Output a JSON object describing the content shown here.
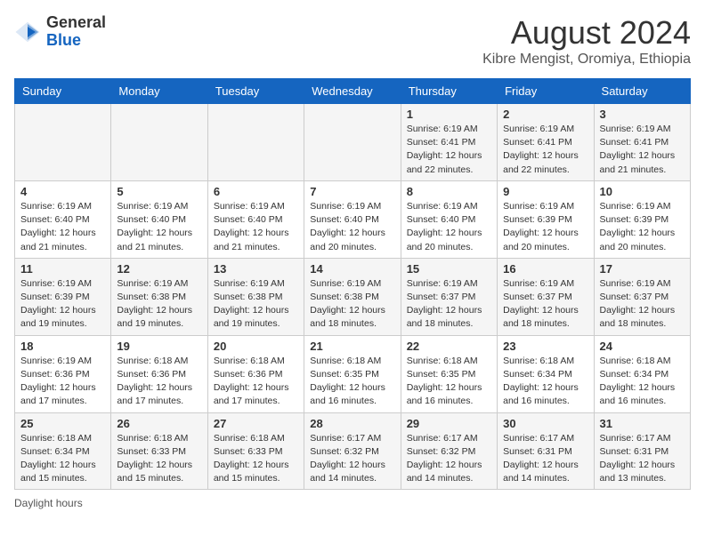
{
  "logo": {
    "general": "General",
    "blue": "Blue"
  },
  "title": "August 2024",
  "subtitle": "Kibre Mengist, Oromiya, Ethiopia",
  "days_of_week": [
    "Sunday",
    "Monday",
    "Tuesday",
    "Wednesday",
    "Thursday",
    "Friday",
    "Saturday"
  ],
  "footer": "Daylight hours",
  "weeks": [
    [
      {
        "day": "",
        "info": ""
      },
      {
        "day": "",
        "info": ""
      },
      {
        "day": "",
        "info": ""
      },
      {
        "day": "",
        "info": ""
      },
      {
        "day": "1",
        "info": "Sunrise: 6:19 AM\nSunset: 6:41 PM\nDaylight: 12 hours\nand 22 minutes."
      },
      {
        "day": "2",
        "info": "Sunrise: 6:19 AM\nSunset: 6:41 PM\nDaylight: 12 hours\nand 22 minutes."
      },
      {
        "day": "3",
        "info": "Sunrise: 6:19 AM\nSunset: 6:41 PM\nDaylight: 12 hours\nand 21 minutes."
      }
    ],
    [
      {
        "day": "4",
        "info": "Sunrise: 6:19 AM\nSunset: 6:40 PM\nDaylight: 12 hours\nand 21 minutes."
      },
      {
        "day": "5",
        "info": "Sunrise: 6:19 AM\nSunset: 6:40 PM\nDaylight: 12 hours\nand 21 minutes."
      },
      {
        "day": "6",
        "info": "Sunrise: 6:19 AM\nSunset: 6:40 PM\nDaylight: 12 hours\nand 21 minutes."
      },
      {
        "day": "7",
        "info": "Sunrise: 6:19 AM\nSunset: 6:40 PM\nDaylight: 12 hours\nand 20 minutes."
      },
      {
        "day": "8",
        "info": "Sunrise: 6:19 AM\nSunset: 6:40 PM\nDaylight: 12 hours\nand 20 minutes."
      },
      {
        "day": "9",
        "info": "Sunrise: 6:19 AM\nSunset: 6:39 PM\nDaylight: 12 hours\nand 20 minutes."
      },
      {
        "day": "10",
        "info": "Sunrise: 6:19 AM\nSunset: 6:39 PM\nDaylight: 12 hours\nand 20 minutes."
      }
    ],
    [
      {
        "day": "11",
        "info": "Sunrise: 6:19 AM\nSunset: 6:39 PM\nDaylight: 12 hours\nand 19 minutes."
      },
      {
        "day": "12",
        "info": "Sunrise: 6:19 AM\nSunset: 6:38 PM\nDaylight: 12 hours\nand 19 minutes."
      },
      {
        "day": "13",
        "info": "Sunrise: 6:19 AM\nSunset: 6:38 PM\nDaylight: 12 hours\nand 19 minutes."
      },
      {
        "day": "14",
        "info": "Sunrise: 6:19 AM\nSunset: 6:38 PM\nDaylight: 12 hours\nand 18 minutes."
      },
      {
        "day": "15",
        "info": "Sunrise: 6:19 AM\nSunset: 6:37 PM\nDaylight: 12 hours\nand 18 minutes."
      },
      {
        "day": "16",
        "info": "Sunrise: 6:19 AM\nSunset: 6:37 PM\nDaylight: 12 hours\nand 18 minutes."
      },
      {
        "day": "17",
        "info": "Sunrise: 6:19 AM\nSunset: 6:37 PM\nDaylight: 12 hours\nand 18 minutes."
      }
    ],
    [
      {
        "day": "18",
        "info": "Sunrise: 6:19 AM\nSunset: 6:36 PM\nDaylight: 12 hours\nand 17 minutes."
      },
      {
        "day": "19",
        "info": "Sunrise: 6:18 AM\nSunset: 6:36 PM\nDaylight: 12 hours\nand 17 minutes."
      },
      {
        "day": "20",
        "info": "Sunrise: 6:18 AM\nSunset: 6:36 PM\nDaylight: 12 hours\nand 17 minutes."
      },
      {
        "day": "21",
        "info": "Sunrise: 6:18 AM\nSunset: 6:35 PM\nDaylight: 12 hours\nand 16 minutes."
      },
      {
        "day": "22",
        "info": "Sunrise: 6:18 AM\nSunset: 6:35 PM\nDaylight: 12 hours\nand 16 minutes."
      },
      {
        "day": "23",
        "info": "Sunrise: 6:18 AM\nSunset: 6:34 PM\nDaylight: 12 hours\nand 16 minutes."
      },
      {
        "day": "24",
        "info": "Sunrise: 6:18 AM\nSunset: 6:34 PM\nDaylight: 12 hours\nand 16 minutes."
      }
    ],
    [
      {
        "day": "25",
        "info": "Sunrise: 6:18 AM\nSunset: 6:34 PM\nDaylight: 12 hours\nand 15 minutes."
      },
      {
        "day": "26",
        "info": "Sunrise: 6:18 AM\nSunset: 6:33 PM\nDaylight: 12 hours\nand 15 minutes."
      },
      {
        "day": "27",
        "info": "Sunrise: 6:18 AM\nSunset: 6:33 PM\nDaylight: 12 hours\nand 15 minutes."
      },
      {
        "day": "28",
        "info": "Sunrise: 6:17 AM\nSunset: 6:32 PM\nDaylight: 12 hours\nand 14 minutes."
      },
      {
        "day": "29",
        "info": "Sunrise: 6:17 AM\nSunset: 6:32 PM\nDaylight: 12 hours\nand 14 minutes."
      },
      {
        "day": "30",
        "info": "Sunrise: 6:17 AM\nSunset: 6:31 PM\nDaylight: 12 hours\nand 14 minutes."
      },
      {
        "day": "31",
        "info": "Sunrise: 6:17 AM\nSunset: 6:31 PM\nDaylight: 12 hours\nand 13 minutes."
      }
    ]
  ]
}
